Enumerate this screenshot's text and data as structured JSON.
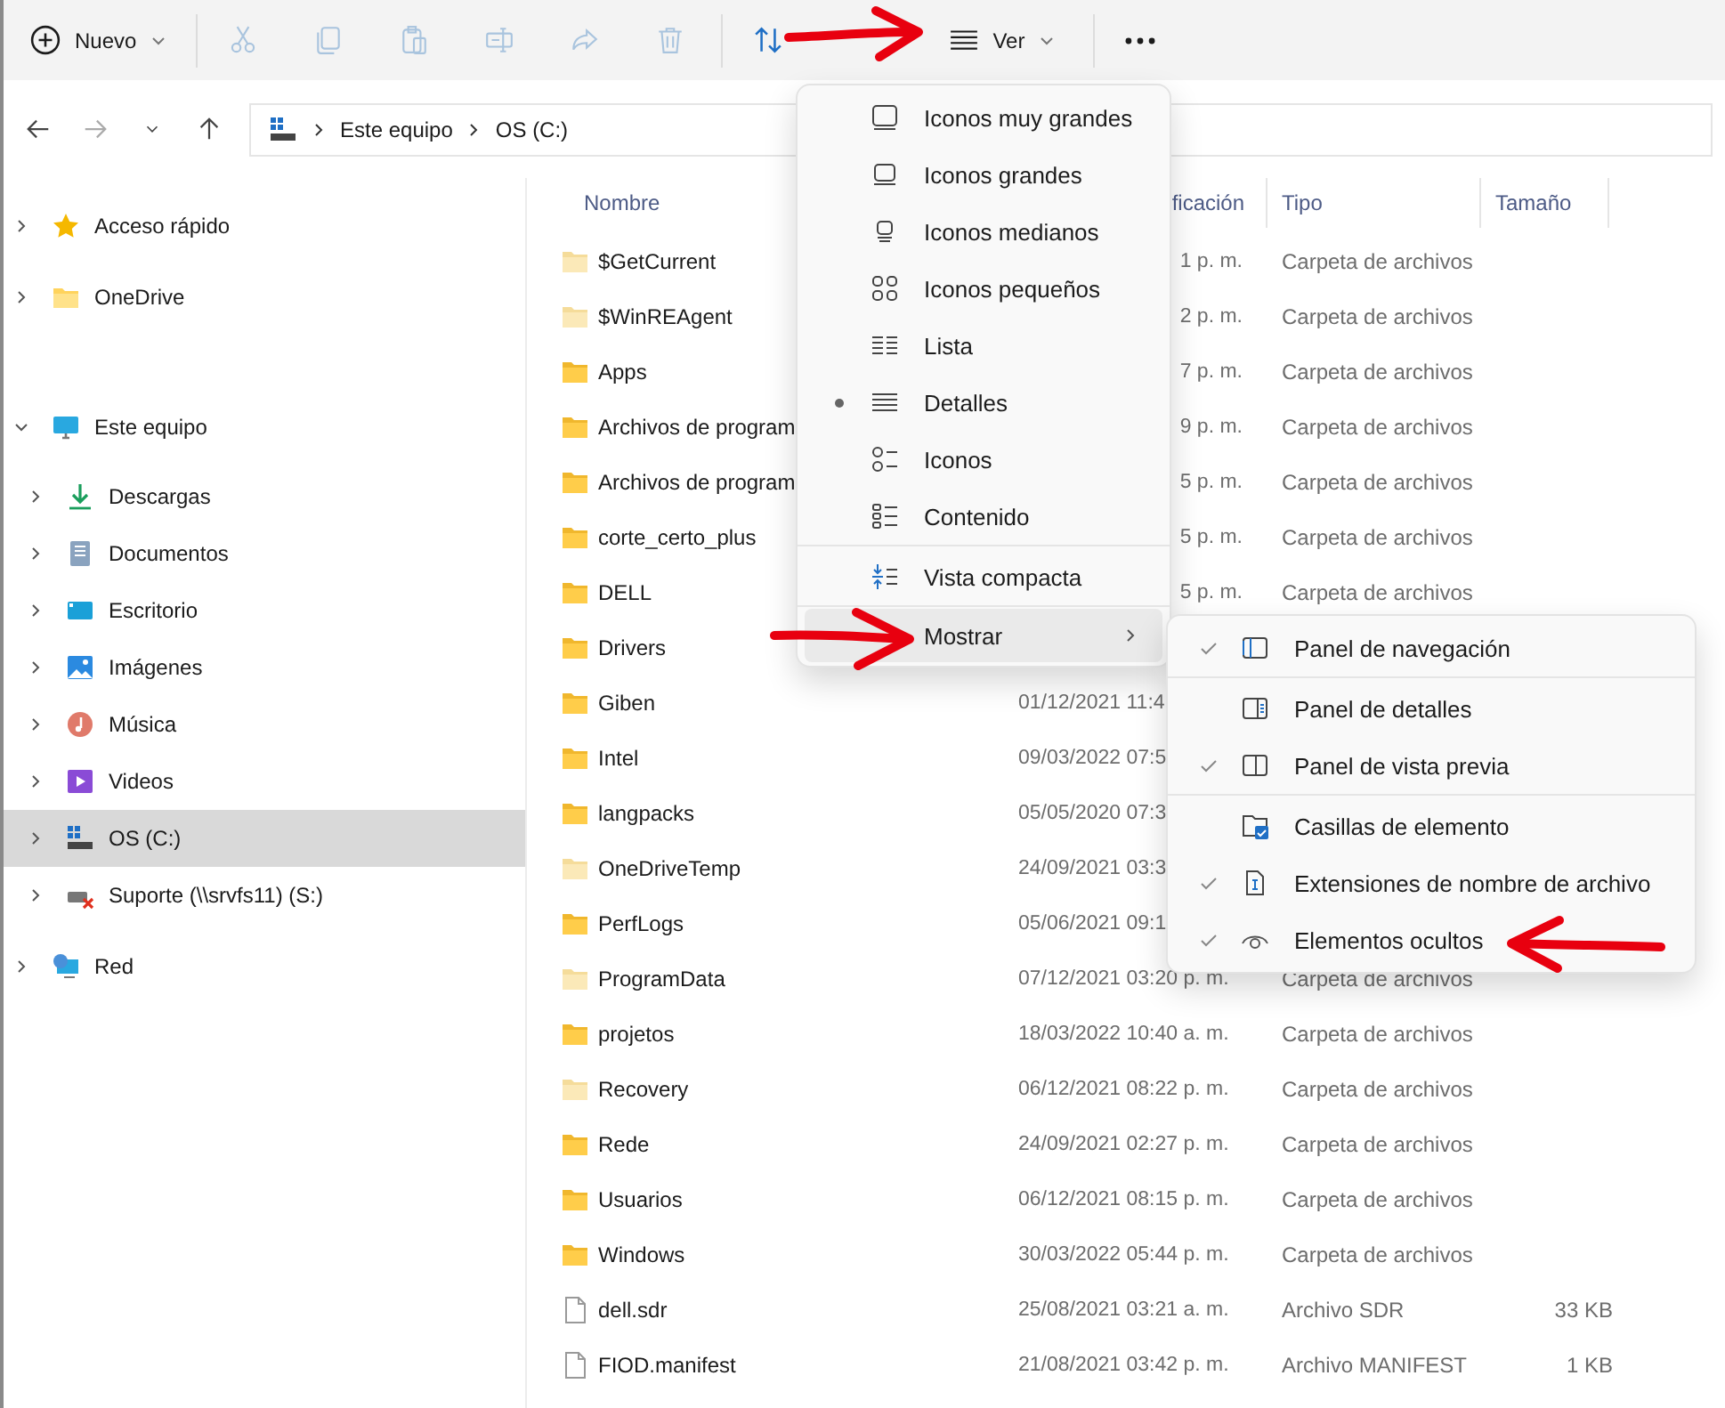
{
  "toolbar": {
    "groups": [
      [
        {
          "kind": "new",
          "label": "Nuevo",
          "dropdown": true,
          "disabled": false
        }
      ],
      [
        {
          "kind": "cut",
          "disabled": true
        },
        {
          "kind": "copy",
          "disabled": true
        },
        {
          "kind": "paste",
          "disabled": true
        },
        {
          "kind": "rename",
          "disabled": true
        },
        {
          "kind": "share",
          "disabled": true
        },
        {
          "kind": "delete",
          "disabled": true
        }
      ],
      [
        {
          "kind": "sort",
          "disabled": false
        },
        {
          "kind": "view",
          "label": "Ver",
          "dropdown": true,
          "disabled": false
        }
      ],
      [
        {
          "kind": "more",
          "disabled": false
        }
      ]
    ]
  },
  "nav": [
    {
      "kind": "back",
      "disabled": false
    },
    {
      "kind": "forward",
      "disabled": true
    },
    {
      "kind": "recent",
      "disabled": false
    },
    {
      "kind": "up",
      "disabled": false
    }
  ],
  "address": {
    "crumbs": [
      "Este equipo",
      "OS (C:)"
    ]
  },
  "sidebar": {
    "sections": [
      {
        "items": [
          {
            "kind": "quick",
            "label": "Acceso rápido",
            "expanded": false,
            "selected": false
          },
          {
            "kind": "onedrive",
            "label": "OneDrive",
            "expanded": false,
            "selected": false
          }
        ]
      },
      {
        "items": [
          {
            "kind": "pc",
            "label": "Este equipo",
            "expanded": true,
            "selected": false,
            "children": [
              {
                "kind": "downloads",
                "label": "Descargas",
                "expanded": false,
                "selected": false
              },
              {
                "kind": "documents",
                "label": "Documentos",
                "expanded": false,
                "selected": false
              },
              {
                "kind": "desktop",
                "label": "Escritorio",
                "expanded": false,
                "selected": false
              },
              {
                "kind": "pictures",
                "label": "Imágenes",
                "expanded": false,
                "selected": false
              },
              {
                "kind": "music",
                "label": "Música",
                "expanded": false,
                "selected": false
              },
              {
                "kind": "videos",
                "label": "Videos",
                "expanded": false,
                "selected": false
              },
              {
                "kind": "drive",
                "label": "OS (C:)",
                "expanded": false,
                "selected": true
              },
              {
                "kind": "netdrive",
                "label": "Suporte (\\\\srvfs11) (S:)",
                "expanded": false,
                "selected": false
              }
            ]
          },
          {
            "kind": "network",
            "label": "Red",
            "expanded": false,
            "selected": false
          }
        ]
      }
    ]
  },
  "table": {
    "columns": [
      {
        "label": "Nombre",
        "partial": false
      },
      {
        "label": "ficación",
        "partial": true
      },
      {
        "label": "Tipo",
        "partial": false
      },
      {
        "label": "Tamaño",
        "partial": false
      }
    ],
    "rows": [
      {
        "kind": "hidden-folder",
        "name": "$GetCurrent",
        "date": "1 p. m.",
        "date_partial": true,
        "type": "Carpeta de archivos"
      },
      {
        "kind": "hidden-folder",
        "name": "$WinREAgent",
        "date": "2 p. m.",
        "date_partial": true,
        "type": "Carpeta de archivos"
      },
      {
        "kind": "folder",
        "name": "Apps",
        "date": "7 p. m.",
        "date_partial": true,
        "type": "Carpeta de archivos"
      },
      {
        "kind": "folder",
        "name": "Archivos de program",
        "date": "9 p. m.",
        "date_partial": true,
        "type": "Carpeta de archivos"
      },
      {
        "kind": "folder",
        "name": "Archivos de program",
        "date": "5 p. m.",
        "date_partial": true,
        "type": "Carpeta de archivos"
      },
      {
        "kind": "folder",
        "name": "corte_certo_plus",
        "date": "5 p. m.",
        "date_partial": true,
        "type": "Carpeta de archivos"
      },
      {
        "kind": "folder",
        "name": "DELL",
        "date": "5 p. m.",
        "date_partial": true,
        "type": "Carpeta de archivos"
      },
      {
        "kind": "folder",
        "name": "Drivers"
      },
      {
        "kind": "folder",
        "name": "Giben",
        "date": "01/12/2021 11:4",
        "date_partial": false
      },
      {
        "kind": "folder",
        "name": "Intel",
        "date": "09/03/2022 07:5",
        "date_partial": false
      },
      {
        "kind": "folder",
        "name": "langpacks",
        "date": "05/05/2020 07:3",
        "date_partial": false
      },
      {
        "kind": "hidden-folder",
        "name": "OneDriveTemp",
        "date": "24/09/2021 03:3",
        "date_partial": false
      },
      {
        "kind": "folder",
        "name": "PerfLogs",
        "date": "05/06/2021 09:1",
        "date_partial": false
      },
      {
        "kind": "hidden-folder",
        "name": "ProgramData",
        "date": "07/12/2021 03:20 p. m.",
        "date_partial": false,
        "type": "Carpeta de archivos"
      },
      {
        "kind": "folder",
        "name": "projetos",
        "date": "18/03/2022 10:40 a. m.",
        "date_partial": false,
        "type": "Carpeta de archivos"
      },
      {
        "kind": "hidden-folder",
        "name": "Recovery",
        "date": "06/12/2021 08:22 p. m.",
        "date_partial": false,
        "type": "Carpeta de archivos"
      },
      {
        "kind": "folder",
        "name": "Rede",
        "date": "24/09/2021 02:27 p. m.",
        "date_partial": false,
        "type": "Carpeta de archivos"
      },
      {
        "kind": "folder",
        "name": "Usuarios",
        "date": "06/12/2021 08:15 p. m.",
        "date_partial": false,
        "type": "Carpeta de archivos"
      },
      {
        "kind": "folder",
        "name": "Windows",
        "date": "30/03/2022 05:44 p. m.",
        "date_partial": false,
        "type": "Carpeta de archivos"
      },
      {
        "kind": "file",
        "name": "dell.sdr",
        "date": "25/08/2021 03:21 a. m.",
        "date_partial": false,
        "type": "Archivo SDR",
        "size": "33 KB"
      },
      {
        "kind": "file",
        "name": "FIOD.manifest",
        "date": "21/08/2021 03:42 p. m.",
        "date_partial": false,
        "type": "Archivo MANIFEST",
        "size": "1 KB"
      }
    ]
  },
  "view_menu": {
    "groups": [
      [
        {
          "kind": "xl",
          "label": "Iconos muy grandes",
          "selected": false
        },
        {
          "kind": "large",
          "label": "Iconos grandes",
          "selected": false
        },
        {
          "kind": "medium",
          "label": "Iconos medianos",
          "selected": false
        },
        {
          "kind": "small",
          "label": "Iconos pequeños",
          "selected": false
        },
        {
          "kind": "list",
          "label": "Lista",
          "selected": false
        },
        {
          "kind": "details",
          "label": "Detalles",
          "selected": true
        },
        {
          "kind": "tiles",
          "label": "Iconos",
          "selected": false
        },
        {
          "kind": "content",
          "label": "Contenido",
          "selected": false
        }
      ],
      [
        {
          "kind": "compact",
          "label": "Vista compacta",
          "selected": false
        }
      ],
      [
        {
          "kind": "submenu",
          "label": "Mostrar",
          "selected": false,
          "expanded": true
        }
      ]
    ]
  },
  "show_menu": {
    "groups": [
      [
        {
          "kind": "navpane",
          "label": "Panel de navegación",
          "checked": true
        }
      ],
      [
        {
          "kind": "detailspane",
          "label": "Panel de detalles",
          "checked": false
        },
        {
          "kind": "previewpane",
          "label": "Panel de vista previa",
          "checked": true
        }
      ],
      [
        {
          "kind": "checkboxes",
          "label": "Casillas de elemento",
          "checked": false
        },
        {
          "kind": "extensions",
          "label": "Extensiones de nombre de archivo",
          "checked": true
        },
        {
          "kind": "hidden",
          "label": "Elementos ocultos",
          "checked": true
        }
      ]
    ]
  }
}
